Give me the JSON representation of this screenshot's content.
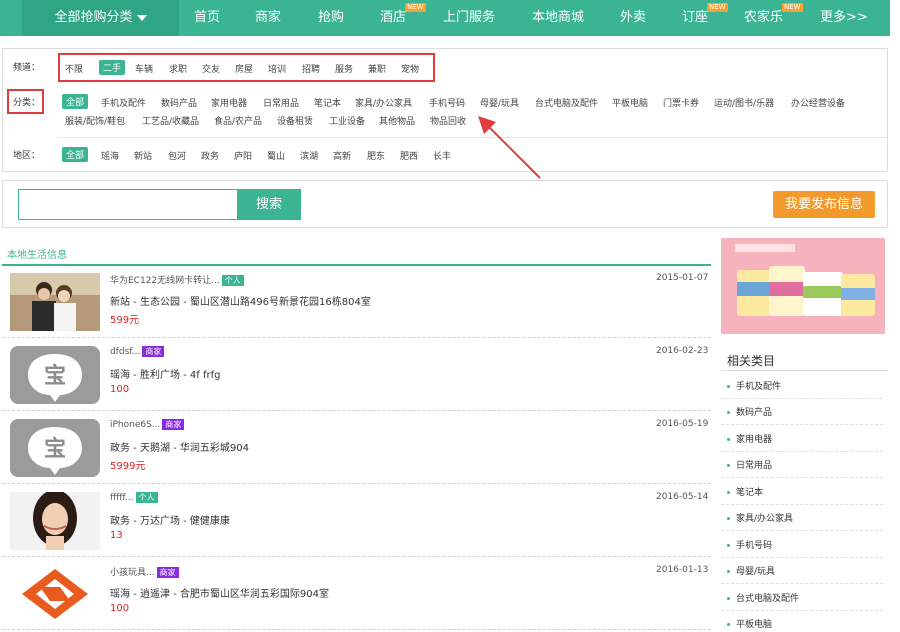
{
  "nav": {
    "category_button": "全部抢购分类",
    "items": [
      {
        "label": "首页",
        "new": ""
      },
      {
        "label": "商家",
        "new": ""
      },
      {
        "label": "抢购",
        "new": ""
      },
      {
        "label": "酒店",
        "new": "NEW"
      },
      {
        "label": "上门服务",
        "new": ""
      },
      {
        "label": "本地商城",
        "new": ""
      },
      {
        "label": "外卖",
        "new": ""
      },
      {
        "label": "订座",
        "new": "NEW"
      },
      {
        "label": "农家乐",
        "new": "NEW"
      },
      {
        "label": "更多>>",
        "new": ""
      }
    ]
  },
  "filters": {
    "channel": {
      "label": "频道：",
      "options": [
        "不限",
        "二手",
        "车辆",
        "求职",
        "交友",
        "房屋",
        "培训",
        "招聘",
        "服务",
        "兼职",
        "宠物"
      ],
      "selected": "二手"
    },
    "category": {
      "label": "分类：",
      "row1": [
        "全部",
        "手机及配件",
        "数码产品",
        "家用电器",
        "日常用品",
        "笔记本",
        "家具/办公家具",
        "手机号码",
        "母婴/玩具",
        "台式电脑及配件",
        "平板电脑",
        "门票卡券",
        "运动/图书/乐器",
        "办公经营设备"
      ],
      "row2": [
        "服装/配饰/鞋包",
        "工艺品/收藏品",
        "食品/农产品",
        "设备租赁",
        "工业设备",
        "其他物品",
        "物品回收"
      ],
      "selected": "全部"
    },
    "area": {
      "label": "地区：",
      "options": [
        "全部",
        "瑶海",
        "新站",
        "包河",
        "政务",
        "庐阳",
        "蜀山",
        "滨湖",
        "高新",
        "肥东",
        "肥西",
        "长丰"
      ],
      "selected": "全部"
    }
  },
  "search": {
    "placeholder": "",
    "button": "搜索",
    "publish": "我要发布信息"
  },
  "listing": {
    "title": "本地生活信息",
    "items": [
      {
        "title": "华为EC122无线网卡转让...",
        "badge": "个人",
        "badge_type": "person",
        "address": "新站 - 生态公园 - 蜀山区潜山路496号新景花园16栋804室",
        "price": "599元",
        "date": "2015-01-07",
        "thumb": "couple-photo"
      },
      {
        "title": "dfdsf...",
        "badge": "商家",
        "badge_type": "merchant",
        "address": "瑶海 - 胜利广场 - 4f frfg",
        "price": "100",
        "date": "2016-02-23",
        "thumb": "bao-logo"
      },
      {
        "title": "iPhone6S...",
        "badge": "商家",
        "badge_type": "merchant",
        "address": "政务 - 天鹅湖 - 华润五彩城904",
        "price": "5999元",
        "date": "2016-05-19",
        "thumb": "bao-logo"
      },
      {
        "title": "fffff...",
        "badge": "个人",
        "badge_type": "person",
        "address": "政务 - 万达广场 - 健健康康",
        "price": "13",
        "date": "2016-05-14",
        "thumb": "woman-photo"
      },
      {
        "title": "小孩玩具...",
        "badge": "商家",
        "badge_type": "merchant",
        "address": "瑶海 - 逍遥津 - 合肥市蜀山区华润五彩国际904室",
        "price": "100",
        "date": "2016-01-13",
        "thumb": "orange-logo"
      }
    ]
  },
  "sidebar": {
    "title": "相关类目",
    "items": [
      "手机及配件",
      "数码产品",
      "家用电器",
      "日常用品",
      "笔记本",
      "家具/办公家具",
      "手机号码",
      "母婴/玩具",
      "台式电脑及配件",
      "平板电脑"
    ]
  },
  "colors": {
    "brand": "#3bb494",
    "accent": "#f39a2d",
    "price": "#e02020",
    "annotation": "#e23b3b"
  }
}
